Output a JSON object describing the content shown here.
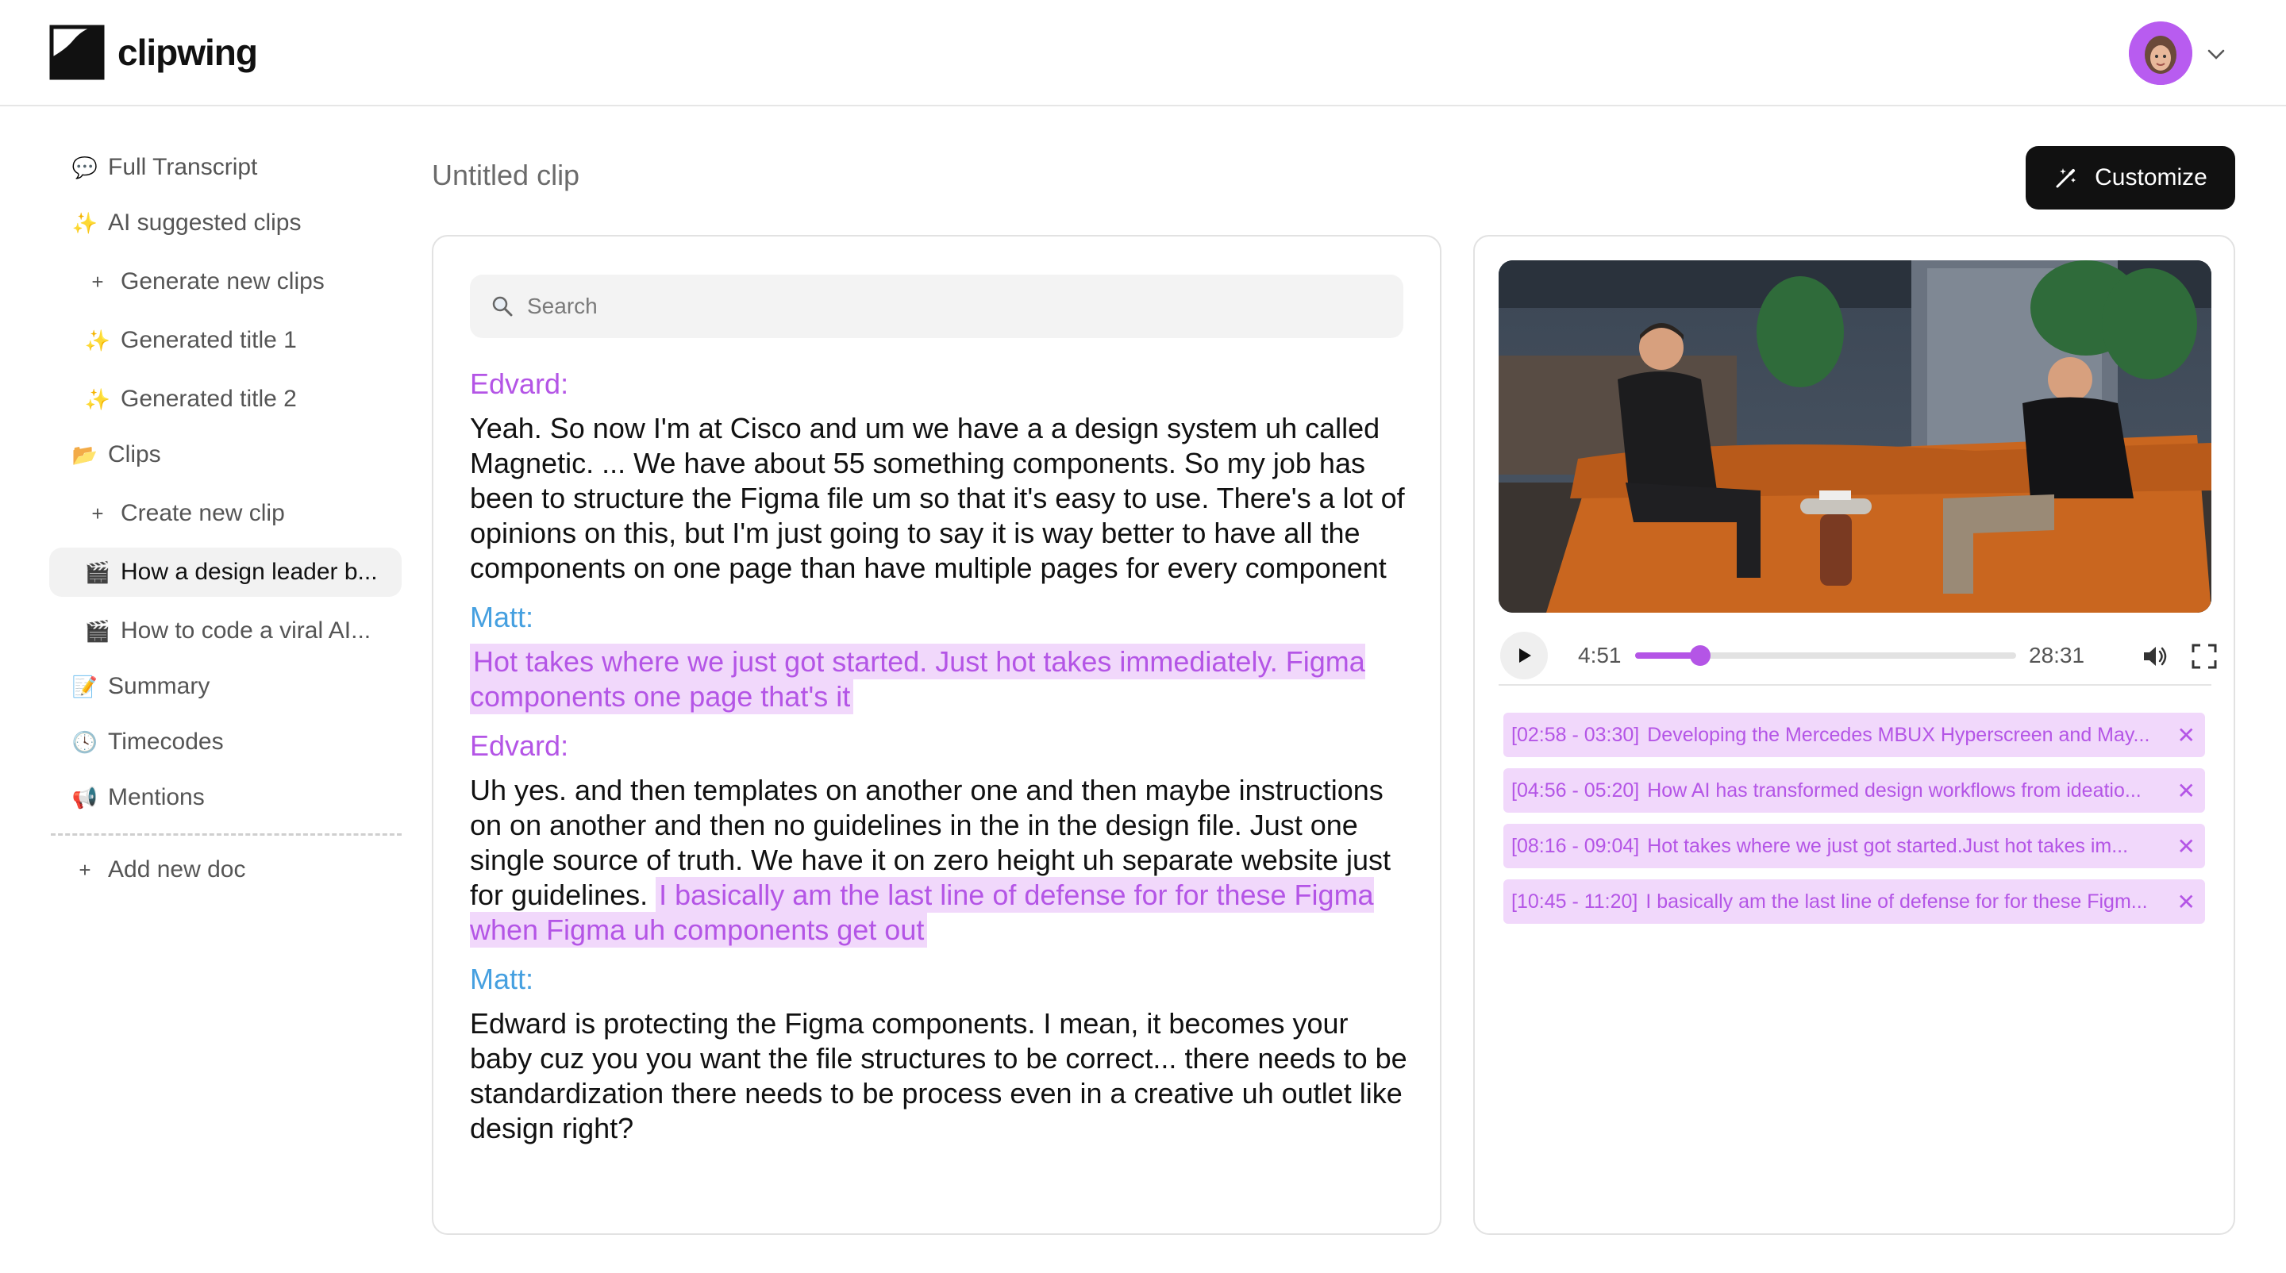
{
  "app": {
    "name": "clipwing"
  },
  "header": {
    "account_menu": "chevron-down-icon"
  },
  "sidebar": {
    "items": [
      {
        "label": "Full Transcript",
        "icon": "💬"
      },
      {
        "label": "AI suggested clips",
        "icon": "✨"
      },
      {
        "label": "Generate new clips",
        "icon": "+"
      },
      {
        "label": "Generated title 1",
        "icon": "✨"
      },
      {
        "label": "Generated title 2",
        "icon": "✨"
      },
      {
        "label": "Clips",
        "icon": "📂"
      },
      {
        "label": "Create new clip",
        "icon": "+"
      },
      {
        "label": "How a design leader b...",
        "icon": "🎬"
      },
      {
        "label": "How to code a viral AI...",
        "icon": "🎬"
      },
      {
        "label": "Summary",
        "icon": "📝"
      },
      {
        "label": "Timecodes",
        "icon": "🕓"
      },
      {
        "label": "Mentions",
        "icon": "📢"
      }
    ],
    "add_doc": "Add new doc"
  },
  "main": {
    "clip_title": "Untitled clip",
    "customize_label": "Customize",
    "search_placeholder": "Search"
  },
  "transcript": [
    {
      "speaker": "Edvard:",
      "segments": [
        {
          "text": "Yeah. So now I'm at Cisco and um we have a a design system uh called Magnetic. ... We have about 55 something components. So my job has been to structure the Figma file um so that it's easy to use. There's a lot of opinions on this, but I'm just going to say it is way better to have all the components on one page than have multiple pages for every component",
          "highlighted": false
        }
      ]
    },
    {
      "speaker": "Matt:",
      "segments": [
        {
          "text": "Hot takes where we just got started. Just hot takes immediately. Figma components one page that's it ",
          "highlighted": true
        }
      ]
    },
    {
      "speaker": "Edvard:",
      "segments": [
        {
          "text": "Uh yes. and then templates on another one and then maybe instructions on on another and then no guidelines in the in the design file. Just one single source of truth. We have it on zero height uh separate website just for guidelines. ",
          "highlighted": false
        },
        {
          "text": "I basically am the last line of defense for for these Figma when Figma uh components get out",
          "highlighted": true
        }
      ]
    },
    {
      "speaker": "Matt:",
      "segments": [
        {
          "text": "Edward is protecting the Figma components. I mean, it becomes your baby cuz you you want the file structures to be correct... there needs to be standardization there needs to be process even in a creative uh outlet like design right?",
          "highlighted": false
        }
      ]
    }
  ],
  "player": {
    "current_time": "4:51",
    "duration": "28:31",
    "progress": 0.17
  },
  "clips": [
    {
      "timecode": "[02:58 - 03:30]",
      "title": "Developing the Mercedes MBUX Hyperscreen and May..."
    },
    {
      "timecode": "[04:56 - 05:20]",
      "title": "How AI has transformed design workflows from ideatio..."
    },
    {
      "timecode": "[08:16 - 09:04]",
      "title": "Hot takes where we just got started.Just hot takes im..."
    },
    {
      "timecode": "[10:45 - 11:20]",
      "title": "I basically am the last line of defense for for these Figm..."
    }
  ],
  "colors": {
    "accent": "#b455e6",
    "speaker_edvard": "#b455e6",
    "speaker_matt": "#46a0e0",
    "highlight_bg": "#f1d8fb"
  }
}
